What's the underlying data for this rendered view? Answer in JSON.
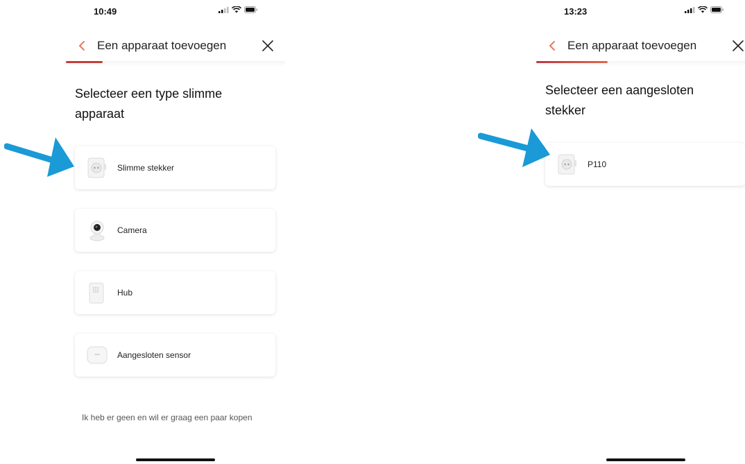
{
  "left": {
    "status_time": "10:49",
    "nav_title": "Een apparaat toevoegen",
    "heading": "Selecteer een type slimme apparaat",
    "cards": [
      {
        "label": "Slimme stekker",
        "icon": "smart-plug-icon"
      },
      {
        "label": "Camera",
        "icon": "camera-icon"
      },
      {
        "label": "Hub",
        "icon": "hub-icon"
      },
      {
        "label": "Aangesloten sensor",
        "icon": "sensor-icon"
      }
    ],
    "footer_link": "Ik heb er geen en wil er graag een paar kopen"
  },
  "right": {
    "status_time": "13:23",
    "nav_title": "Een apparaat toevoegen",
    "heading": "Selecteer een aangesloten stekker",
    "cards": [
      {
        "label": "P110",
        "icon": "smart-plug-icon"
      }
    ]
  },
  "colors": {
    "accent": "#c43d3a",
    "arrow": "#1a9ad6"
  }
}
